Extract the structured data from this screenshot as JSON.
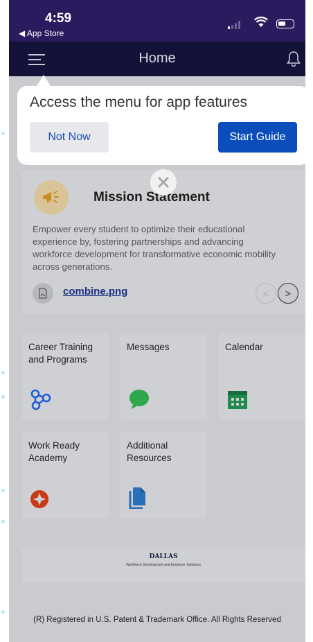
{
  "status_bar": {
    "time": "4:59",
    "back_label": "◀ App Store"
  },
  "header": {
    "title": "Home",
    "menu_icon": "hamburger-icon",
    "bell_icon": "bell-icon"
  },
  "tooltip": {
    "message": "Access the menu for app features",
    "not_now_label": "Not Now",
    "start_guide_label": "Start Guide"
  },
  "mission": {
    "title": "Mission Statement",
    "body": "Empower every student to optimize their educational experience by, fostering partnerships and advancing workforce development for transformative economic mobility across generations.",
    "file_name": "combine.png",
    "prev_label": "<",
    "next_label": ">"
  },
  "tiles": [
    {
      "label": "Career Training and Programs",
      "icon": "network-icon",
      "color": "#1f5fd6"
    },
    {
      "label": "Messages",
      "icon": "chat-bubble-icon",
      "color": "#2ea84a"
    },
    {
      "label": "Calendar",
      "icon": "calendar-icon",
      "color": "#1e8a4c"
    },
    {
      "label": "Work Ready Academy",
      "icon": "star-badge-icon",
      "color": "#c83a18"
    },
    {
      "label": "Additional Resources",
      "icon": "document-icon",
      "color": "#2a6fb8"
    }
  ],
  "footer": {
    "logo_text": "DALLAS",
    "logo_sub": "Workforce Development and Employer Solutions",
    "copyright": "(R) Registered in U.S. Patent & Trademark Office. All Rights Reserved"
  },
  "colors": {
    "status_bg": "#2a1a5e",
    "header_bg": "#15123a",
    "primary_button": "#0b4dbb"
  }
}
